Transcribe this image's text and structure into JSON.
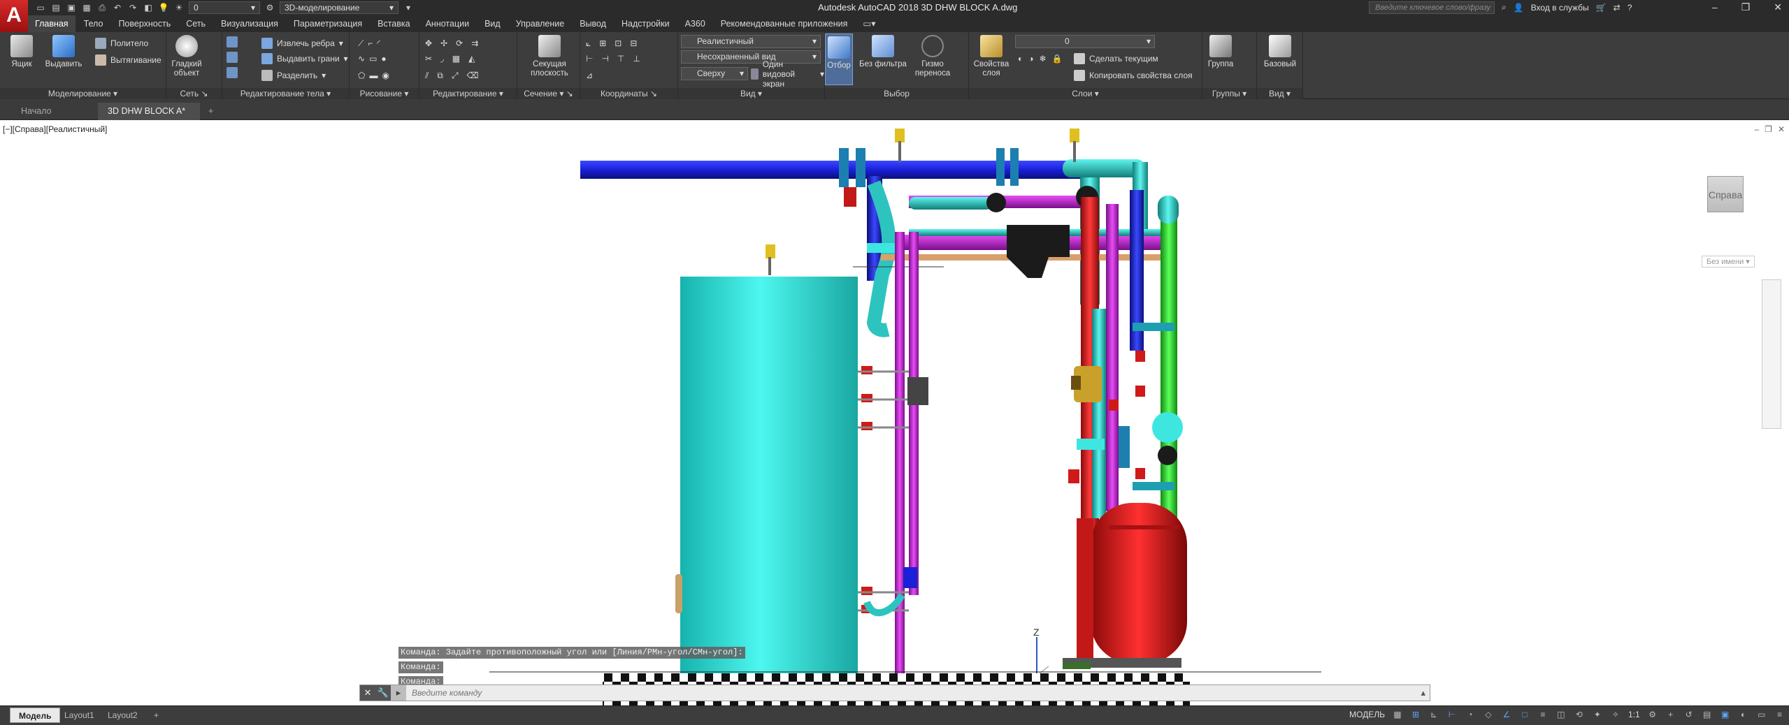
{
  "titlebar": {
    "logo": "A",
    "title": "Autodesk AutoCAD 2018    3D DHW BLOCK A.dwg",
    "layer_combo": "0",
    "workspace": "3D-моделирование",
    "search_placeholder": "Введите ключевое слово/фразу",
    "sign_in": "Вход в службы"
  },
  "tabs": [
    "Главная",
    "Тело",
    "Поверхность",
    "Сеть",
    "Визуализация",
    "Параметризация",
    "Вставка",
    "Аннотации",
    "Вид",
    "Управление",
    "Вывод",
    "Надстройки",
    "A360",
    "Рекомендованные приложения"
  ],
  "ribbon": {
    "modeling": {
      "title": "Моделирование",
      "box": "Ящик",
      "extrude": "Выдавить",
      "polysolid": "Политело",
      "sweep": "Вытягивание"
    },
    "mesh": {
      "title": "Сеть",
      "smooth": "Гладкий объект"
    },
    "solid_edit": {
      "title": "Редактирование тела",
      "extract_edges": "Извлечь ребра",
      "extrude_faces": "Выдавить грани",
      "separate": "Разделить"
    },
    "draw": {
      "title": "Рисование"
    },
    "modify": {
      "title": "Редактирование"
    },
    "section": {
      "title": "Сечение",
      "plane": "Секущая плоскость"
    },
    "coordinates": {
      "title": "Координаты"
    },
    "view": {
      "title": "Вид",
      "visual_style": "Реалистичный",
      "named_view": "Несохраненный вид",
      "view_direction": "Сверху",
      "viewport_config": "Один видовой экран"
    },
    "selection": {
      "title": "Выбор",
      "culling": "Отбор",
      "no_filter": "Без фильтра",
      "gizmo": "Гизмо переноса"
    },
    "layers": {
      "title": "Слои",
      "layer_props": "Свойства слоя",
      "layer_name": "0",
      "make_current": "Сделать текущим",
      "match_layer": "Копировать свойства слоя"
    },
    "groups": {
      "title": "Группы",
      "group": "Группа"
    },
    "view2": {
      "title": "Вид",
      "base": "Базовый"
    }
  },
  "filetabs": {
    "start": "Начало",
    "doc": "3D DHW BLOCK A*",
    "add": "+"
  },
  "viewport": {
    "label": "[−][Справа][Реалистичный]",
    "viewcube": "Справа",
    "wcs": "Без имени",
    "axis_z": "Z"
  },
  "command_history": [
    "Команда: Задайте противоположный угол или [Линия/РМн-угол/СМн-угол]:",
    "Команда:",
    "Команда:"
  ],
  "command_placeholder": "Введите команду",
  "status": {
    "layout_tabs": [
      "Модель",
      "Layout1",
      "Layout2"
    ],
    "model_space": "МОДЕЛЬ",
    "scale": "1:1"
  },
  "colors": {
    "background_dark": "#2b2b2b",
    "ribbon": "#3d3d3d",
    "tank": "#3ee6e0",
    "pipe_blue": "#1a20d8",
    "pipe_magenta": "#c21fd6",
    "pipe_red": "#e01a1a",
    "pipe_green": "#2bd82b",
    "expansion_tank": "#d81f1f"
  }
}
